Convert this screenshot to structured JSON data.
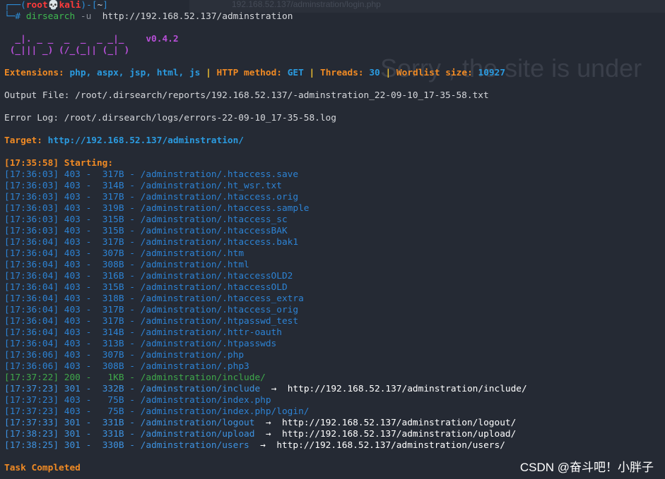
{
  "background_text": "Sorry , the site is under",
  "top_strip_text": "192.168.52.137/adminstration/login.php",
  "prompt": {
    "open": "┌──(",
    "user": "root💀kali",
    "close": ")-[",
    "dir": "~",
    "end": "]",
    "hash": "└─#",
    "command": "dirsearch",
    "flag": "-u",
    "url": "http://192.168.52.137/adminstration"
  },
  "logo": {
    "line1": "  _|. _ _  _  _  _ _|_    ",
    "line2": " (_||| _) (/_(_|| (_| )",
    "version": "v0.4.2"
  },
  "config": {
    "ext_label": "Extensions:",
    "ext_value": "php, aspx, jsp, html, js",
    "method_label": "HTTP method:",
    "method_value": "GET",
    "threads_label": "Threads:",
    "threads_value": "30",
    "wordlist_label": "Wordlist size:",
    "wordlist_value": "10927",
    "bar": "|"
  },
  "output_file": "Output File: /root/.dirsearch/reports/192.168.52.137/-adminstration_22-09-10_17-35-58.txt",
  "error_log": "Error Log: /root/.dirsearch/logs/errors-22-09-10_17-35-58.log",
  "target": {
    "label": "Target:",
    "url": "http://192.168.52.137/adminstration/"
  },
  "starting": "[17:35:58] Starting:",
  "results": [
    {
      "time": "[17:36:03]",
      "status": "403",
      "size": "317B",
      "path": "/adminstration/.htaccess.save",
      "redirect": ""
    },
    {
      "time": "[17:36:03]",
      "status": "403",
      "size": "314B",
      "path": "/adminstration/.ht_wsr.txt",
      "redirect": ""
    },
    {
      "time": "[17:36:03]",
      "status": "403",
      "size": "317B",
      "path": "/adminstration/.htaccess.orig",
      "redirect": ""
    },
    {
      "time": "[17:36:03]",
      "status": "403",
      "size": "319B",
      "path": "/adminstration/.htaccess.sample",
      "redirect": ""
    },
    {
      "time": "[17:36:03]",
      "status": "403",
      "size": "315B",
      "path": "/adminstration/.htaccess_sc",
      "redirect": ""
    },
    {
      "time": "[17:36:03]",
      "status": "403",
      "size": "315B",
      "path": "/adminstration/.htaccessBAK",
      "redirect": ""
    },
    {
      "time": "[17:36:04]",
      "status": "403",
      "size": "317B",
      "path": "/adminstration/.htaccess.bak1",
      "redirect": ""
    },
    {
      "time": "[17:36:04]",
      "status": "403",
      "size": "307B",
      "path": "/adminstration/.htm",
      "redirect": ""
    },
    {
      "time": "[17:36:04]",
      "status": "403",
      "size": "308B",
      "path": "/adminstration/.html",
      "redirect": ""
    },
    {
      "time": "[17:36:04]",
      "status": "403",
      "size": "316B",
      "path": "/adminstration/.htaccessOLD2",
      "redirect": ""
    },
    {
      "time": "[17:36:04]",
      "status": "403",
      "size": "315B",
      "path": "/adminstration/.htaccessOLD",
      "redirect": ""
    },
    {
      "time": "[17:36:04]",
      "status": "403",
      "size": "318B",
      "path": "/adminstration/.htaccess_extra",
      "redirect": ""
    },
    {
      "time": "[17:36:04]",
      "status": "403",
      "size": "317B",
      "path": "/adminstration/.htaccess_orig",
      "redirect": ""
    },
    {
      "time": "[17:36:04]",
      "status": "403",
      "size": "317B",
      "path": "/adminstration/.htpasswd_test",
      "redirect": ""
    },
    {
      "time": "[17:36:04]",
      "status": "403",
      "size": "314B",
      "path": "/adminstration/.httr-oauth",
      "redirect": ""
    },
    {
      "time": "[17:36:04]",
      "status": "403",
      "size": "313B",
      "path": "/adminstration/.htpasswds",
      "redirect": ""
    },
    {
      "time": "[17:36:06]",
      "status": "403",
      "size": "307B",
      "path": "/adminstration/.php",
      "redirect": ""
    },
    {
      "time": "[17:36:06]",
      "status": "403",
      "size": "308B",
      "path": "/adminstration/.php3",
      "redirect": ""
    },
    {
      "time": "[17:37:22]",
      "status": "200",
      "size": "1KB",
      "path": "/adminstration/include/",
      "redirect": ""
    },
    {
      "time": "[17:37:23]",
      "status": "301",
      "size": "332B",
      "path": "/adminstration/include",
      "redirect": "http://192.168.52.137/adminstration/include/"
    },
    {
      "time": "[17:37:23]",
      "status": "403",
      "size": "75B",
      "path": "/adminstration/index.php",
      "redirect": ""
    },
    {
      "time": "[17:37:23]",
      "status": "403",
      "size": "75B",
      "path": "/adminstration/index.php/login/",
      "redirect": ""
    },
    {
      "time": "[17:37:33]",
      "status": "301",
      "size": "331B",
      "path": "/adminstration/logout",
      "redirect": "http://192.168.52.137/adminstration/logout/"
    },
    {
      "time": "[17:38:23]",
      "status": "301",
      "size": "331B",
      "path": "/adminstration/upload",
      "redirect": "http://192.168.52.137/adminstration/upload/"
    },
    {
      "time": "[17:38:25]",
      "status": "301",
      "size": "330B",
      "path": "/adminstration/users",
      "redirect": "http://192.168.52.137/adminstration/users/"
    }
  ],
  "arrow": "→",
  "task_completed": "Task Completed",
  "watermark": "CSDN @奋斗吧！小胖子",
  "colors": {
    "background": "#252a34",
    "prompt_blue": "#2d8ed8",
    "prompt_red": "#ff3b3b",
    "orange": "#f08a24",
    "purple": "#b84fd8",
    "status_403": "#2d83d4",
    "status_200": "#3fa84a",
    "status_301": "#3d92e0"
  }
}
